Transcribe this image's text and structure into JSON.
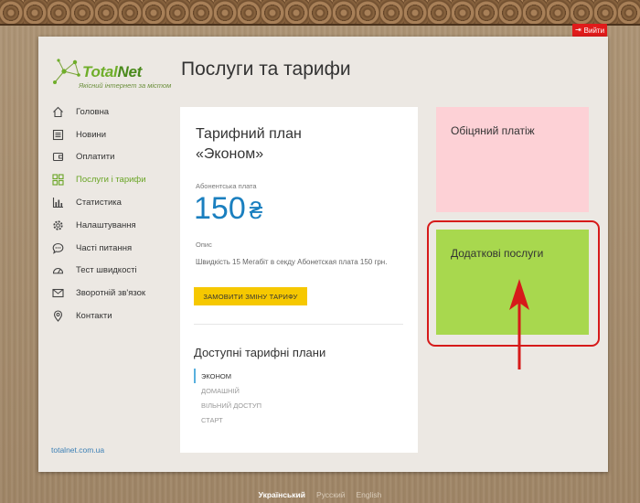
{
  "header": {
    "logout_label": "Вийти"
  },
  "brand": {
    "name_total": "Total",
    "name_net": "Net",
    "tagline": "Якісний інтернет за містом"
  },
  "sidebar": {
    "items": [
      {
        "label": "Головна",
        "icon": "home-icon",
        "active": false
      },
      {
        "label": "Новини",
        "icon": "news-icon",
        "active": false
      },
      {
        "label": "Оплатити",
        "icon": "wallet-icon",
        "active": false
      },
      {
        "label": "Послуги і тарифи",
        "icon": "grid-icon",
        "active": true
      },
      {
        "label": "Статистика",
        "icon": "bar-chart-icon",
        "active": false
      },
      {
        "label": "Налаштування",
        "icon": "gear-icon",
        "active": false
      },
      {
        "label": "Часті питання",
        "icon": "chat-icon",
        "active": false
      },
      {
        "label": "Тест швидкості",
        "icon": "speedometer-icon",
        "active": false
      },
      {
        "label": "Зворотній зв'язок",
        "icon": "mail-icon",
        "active": false
      },
      {
        "label": "Контакти",
        "icon": "location-pin-icon",
        "active": false
      }
    ],
    "site_link": "totalnet.com.ua"
  },
  "main": {
    "title": "Послуги та тарифи",
    "plan_card": {
      "title_line1": "Тарифний план",
      "title_line2": "«Эконом»",
      "fee_label": "Абонентська плата",
      "fee_value": "150",
      "currency": "₴",
      "desc_label": "Опис",
      "description": "Швидкість 15 Мегабіт в секду Абонетская плата 150 грн.",
      "order_button": "ЗАМОВИТИ ЗМІНУ ТАРИФУ",
      "available_title": "Доступні тарифні плани",
      "plans": [
        {
          "label": "ЭКОНОМ",
          "active": true
        },
        {
          "label": "ДОМАШНІЙ",
          "active": false
        },
        {
          "label": "ВІЛЬНИЙ ДОСТУП",
          "active": false
        },
        {
          "label": "СТАРТ",
          "active": false
        }
      ]
    },
    "tiles": {
      "promised_payment": "Обіцяний платіж",
      "additional_services": "Додаткові послуги"
    }
  },
  "footer": {
    "languages": [
      {
        "label": "Український",
        "active": true
      },
      {
        "label": "Русский",
        "active": false
      },
      {
        "label": "English",
        "active": false
      }
    ]
  },
  "colors": {
    "accent_green": "#6aa526",
    "tile_pink": "#fdd1d6",
    "tile_green": "#a8d84e",
    "button_yellow": "#f6c800",
    "price_blue": "#1a7fbf",
    "highlight_red": "#d61a1a"
  }
}
